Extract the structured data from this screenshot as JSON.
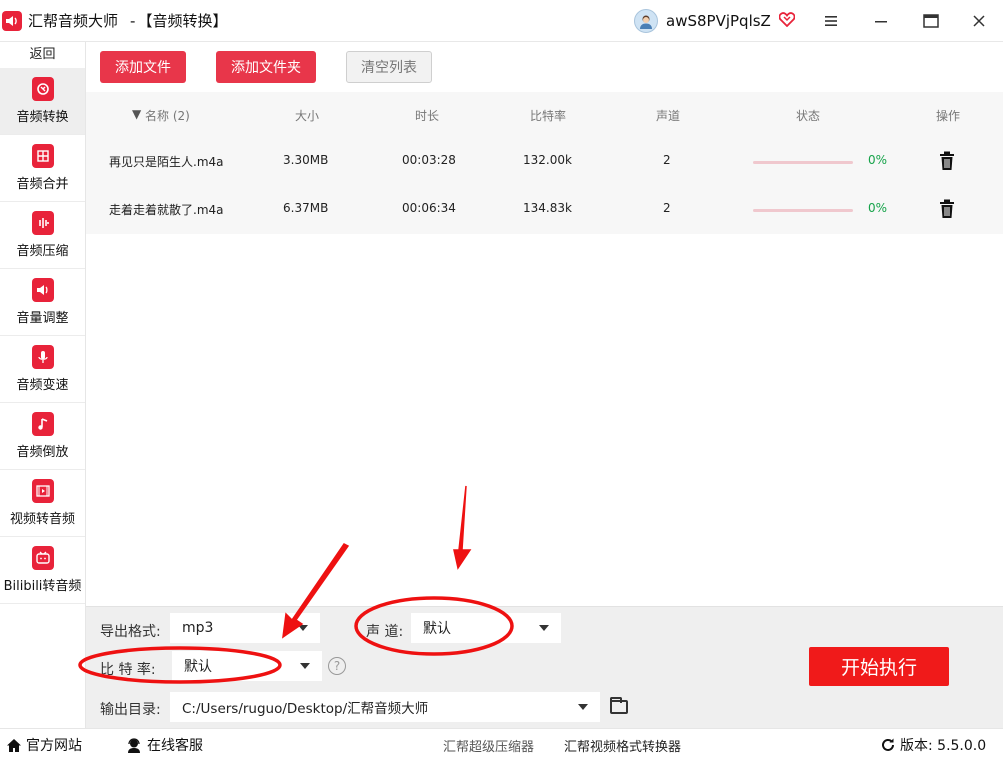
{
  "app": {
    "name": "汇帮音频大师",
    "separator": "-",
    "module": "【音频转换】",
    "logo_icon": "speaker-icon"
  },
  "user": {
    "name": "awS8PVjPqlsZ",
    "vip_icon": "heart-vip-icon"
  },
  "window_controls": [
    "menu-icon",
    "minimize-icon",
    "maximize-icon",
    "close-icon"
  ],
  "sidebar": {
    "back_label": "返回",
    "items": [
      {
        "label": "音频转换",
        "icon": "audio-convert-icon",
        "active": true
      },
      {
        "label": "音频合并",
        "icon": "audio-merge-icon",
        "active": false
      },
      {
        "label": "音频压缩",
        "icon": "audio-compress-icon",
        "active": false
      },
      {
        "label": "音量调整",
        "icon": "volume-icon",
        "active": false
      },
      {
        "label": "音频变速",
        "icon": "microphone-icon",
        "active": false
      },
      {
        "label": "音频倒放",
        "icon": "music-note-icon",
        "active": false
      },
      {
        "label": "视频转音频",
        "icon": "film-icon",
        "active": false
      },
      {
        "label": "Bilibili转音频",
        "icon": "tv-icon",
        "active": false
      }
    ]
  },
  "toolbar": {
    "add_file": "添加文件",
    "add_folder": "添加文件夹",
    "clear_list": "清空列表"
  },
  "table": {
    "headers": {
      "name": "名称 (2)",
      "size": "大小",
      "duration": "时长",
      "bitrate": "比特率",
      "channel": "声道",
      "status": "状态",
      "action": "操作"
    },
    "rows": [
      {
        "name": "再见只是陌生人.m4a",
        "size": "3.30MB",
        "duration": "00:03:28",
        "bitrate": "132.00k",
        "channel": "2",
        "progress": 0,
        "progress_text": "0%"
      },
      {
        "name": "走着走着就散了.m4a",
        "size": "6.37MB",
        "duration": "00:06:34",
        "bitrate": "134.83k",
        "channel": "2",
        "progress": 0,
        "progress_text": "0%"
      }
    ]
  },
  "settings": {
    "format_label": "导出格式:",
    "format_value": "mp3",
    "channel_label": "声 道:",
    "channel_value": "默认",
    "bitrate_label": "比 特 率:",
    "bitrate_value": "默认",
    "help": "?",
    "output_label": "输出目录:",
    "output_value": "C:/Users/ruguo/Desktop/汇帮音频大师",
    "start_label": "开始执行"
  },
  "statusbar": {
    "website": "官方网站",
    "support": "在线客服",
    "link1": "汇帮超级压缩器",
    "link2": "汇帮视频格式转换器",
    "version": "版本:  5.5.0.0"
  },
  "colors": {
    "accent": "#e8233a",
    "start_button": "#f01a1a",
    "progress_text": "#16a34a",
    "annotation": "#ee1111"
  }
}
